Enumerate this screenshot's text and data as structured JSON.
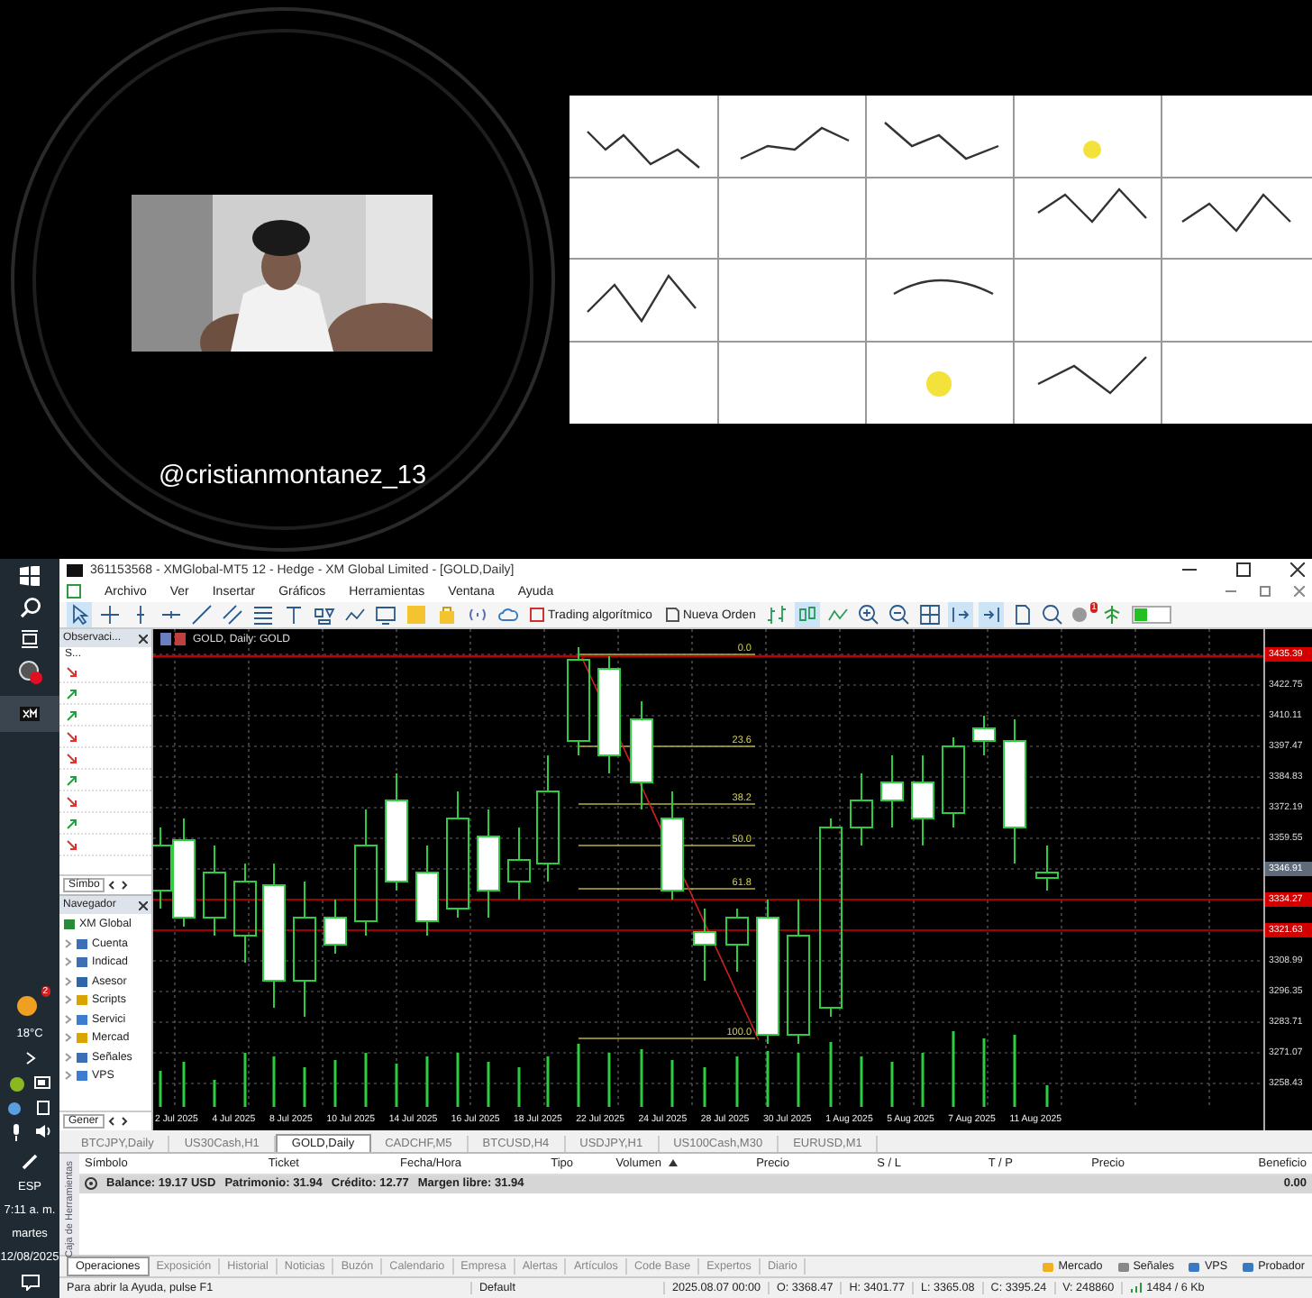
{
  "stream": {
    "handle": "@cristianmontanez_13"
  },
  "taskbar": {
    "weather_badge": "2",
    "temperature": "18°C",
    "language": "ESP",
    "time": "7:11 a. m.",
    "day": "martes",
    "date": "12/08/2025"
  },
  "window": {
    "title": "361153568 - XMGlobal-MT5 12 - Hedge - XM Global Limited - [GOLD,Daily]",
    "menu": [
      "Archivo",
      "Ver",
      "Insertar",
      "Gráficos",
      "Herramientas",
      "Ventana",
      "Ayuda"
    ],
    "toolbar_buttons": [
      "Trading algorítmico",
      "Nueva Orden"
    ],
    "alert_badge": "1"
  },
  "market_watch": {
    "title": "Observaci...",
    "column": "S...",
    "tab": "Símbo",
    "rows": [
      {
        "rising": false
      },
      {
        "rising": true
      },
      {
        "rising": true
      },
      {
        "rising": false
      },
      {
        "rising": false
      },
      {
        "rising": true
      },
      {
        "rising": false
      },
      {
        "rising": true
      },
      {
        "rising": false
      }
    ]
  },
  "navigator": {
    "title": "Navegador",
    "tab": "Gener",
    "items": [
      {
        "label": "XM Global"
      },
      {
        "label": "Cuenta"
      },
      {
        "label": "Indicad"
      },
      {
        "label": "Asesor"
      },
      {
        "label": "Scripts"
      },
      {
        "label": "Servici"
      },
      {
        "label": "Mercad"
      },
      {
        "label": "Señales"
      },
      {
        "label": "VPS"
      }
    ]
  },
  "chart": {
    "title": "GOLD, Daily: GOLD",
    "fib_levels": [
      "0.0",
      "23.6",
      "38.2",
      "50.0",
      "61.8",
      "100.0"
    ],
    "price_labels": [
      {
        "text": "3435.39",
        "color": "#d40000"
      },
      {
        "text": "3422.75"
      },
      {
        "text": "3410.11"
      },
      {
        "text": "3397.47"
      },
      {
        "text": "3384.83"
      },
      {
        "text": "3372.19"
      },
      {
        "text": "3359.55"
      },
      {
        "text": "3346.91",
        "color": "#5f6b7a"
      },
      {
        "text": "3334.27",
        "color": "#d40000"
      },
      {
        "text": "3321.63",
        "color": "#d40000"
      },
      {
        "text": "3308.99"
      },
      {
        "text": "3296.35"
      },
      {
        "text": "3283.71"
      },
      {
        "text": "3271.07"
      },
      {
        "text": "3258.43"
      }
    ],
    "date_labels": [
      "2 Jul 2025",
      "4 Jul 2025",
      "8 Jul 2025",
      "10 Jul 2025",
      "14 Jul 2025",
      "16 Jul 2025",
      "18 Jul 2025",
      "22 Jul 2025",
      "24 Jul 2025",
      "28 Jul 2025",
      "30 Jul 2025",
      "1 Aug 2025",
      "5 Aug 2025",
      "7 Aug 2025",
      "11 Aug 2025"
    ]
  },
  "chart_tabs": [
    {
      "label": "BTCJPY,Daily",
      "selected": false
    },
    {
      "label": "US30Cash,H1",
      "selected": false
    },
    {
      "label": "GOLD,Daily",
      "selected": true
    },
    {
      "label": "CADCHF,M5",
      "selected": false
    },
    {
      "label": "BTCUSD,H4",
      "selected": false
    },
    {
      "label": "USDJPY,H1",
      "selected": false
    },
    {
      "label": "US100Cash,M30",
      "selected": false
    },
    {
      "label": "EURUSD,M1",
      "selected": false
    }
  ],
  "toolbox": {
    "title": "Caja de Herramientas",
    "columns": [
      {
        "label": "Símbolo",
        "sorted": false
      },
      {
        "label": "Ticket",
        "sorted": false
      },
      {
        "label": "Fecha/Hora",
        "sorted": false
      },
      {
        "label": "Tipo",
        "sorted": false
      },
      {
        "label": "Volumen",
        "sorted": true
      },
      {
        "label": "Precio",
        "sorted": false
      },
      {
        "label": "S / L",
        "sorted": false
      },
      {
        "label": "T / P",
        "sorted": false
      },
      {
        "label": "Precio",
        "sorted": false
      },
      {
        "label": "Beneficio",
        "sorted": false
      }
    ],
    "summary": [
      "Balance: 19.17 USD",
      "Patrimonio: 31.94",
      "Crédito: 12.77",
      "Margen libre: 31.94"
    ],
    "profit": "0.00",
    "tabs": [
      {
        "label": "Operaciones",
        "selected": true
      },
      {
        "label": "Exposición",
        "selected": false
      },
      {
        "label": "Historial",
        "selected": false
      },
      {
        "label": "Noticias",
        "selected": false
      },
      {
        "label": "Buzón",
        "selected": false
      },
      {
        "label": "Calendario",
        "selected": false
      },
      {
        "label": "Empresa",
        "selected": false
      },
      {
        "label": "Alertas",
        "selected": false
      },
      {
        "label": "Artículos",
        "selected": false
      },
      {
        "label": "Code Base",
        "selected": false
      },
      {
        "label": "Expertos",
        "selected": false
      },
      {
        "label": "Diario",
        "selected": false
      }
    ],
    "links": [
      "Mercado",
      "Señales",
      "VPS",
      "Probador"
    ]
  },
  "status_bar": {
    "help": "Para abrir la Ayuda, pulse F1",
    "profile": "Default",
    "datetime": "2025.08.07 00:00",
    "ohlc": [
      "O: 3368.47",
      "H: 3401.77",
      "L: 3365.08",
      "C: 3395.24",
      "V: 248860"
    ],
    "traffic": "1484 / 6 Kb"
  }
}
